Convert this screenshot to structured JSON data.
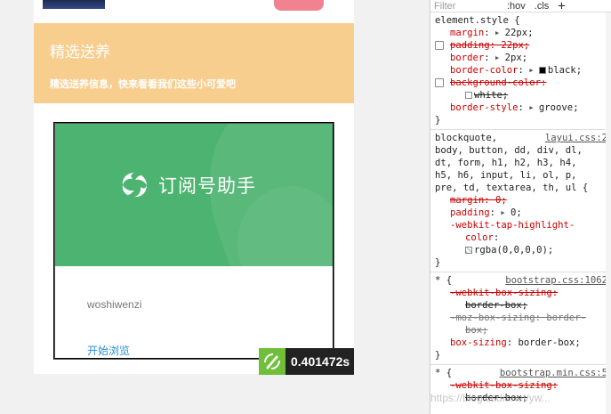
{
  "preview": {
    "banner_title": "精选送养",
    "banner_subtitle": "精选送养信息，快来看看我们这些小可爱吧",
    "card": {
      "logo_text": "订阅号助手",
      "author": "woshiwenzi",
      "link": "开始浏览"
    },
    "timer": "0.401472s",
    "colors": {
      "banner": "#f8ce8f",
      "cover": "#4db370",
      "accent_button": "#f0838f",
      "link": "#2a8fd6"
    }
  },
  "devtools": {
    "filter_placeholder": "Filter",
    "hov": ":hov",
    "cls": ".cls",
    "plus": "+",
    "r1": {
      "selector": "element.style {",
      "d1_name": "margin",
      "d1_val": "22px;",
      "d2": "padding: 22px;",
      "d3_name": "border",
      "d3_val": "2px;",
      "d4_name": "border-color",
      "d4_val": "black;",
      "d5": "background-color:",
      "d5_cont": "white;",
      "d6_name": "border-style",
      "d6_val": "groove;",
      "close": "}"
    },
    "r2": {
      "source": "layui.css:2",
      "sel1": "blockquote,",
      "sel2": "body, button, dd, div, dl,",
      "sel3": "dt, form, h1, h2, h3, h4,",
      "sel4": "h5, h6, input, li, ol, p,",
      "sel5": "pre, td, textarea, th, ul {",
      "d1": "margin: 0;",
      "d2_name": "padding",
      "d2_val": "0;",
      "d3_name": "-webkit-tap-highlight-",
      "d3_name2": "color",
      "d3_val": "rgba(0,0,0,0);",
      "close": "}"
    },
    "r3": {
      "selector": "* {",
      "source": "bootstrap.css:1062",
      "d1": "-webkit-box-sizing:",
      "d1_cont": "border-box;",
      "d2": "-moz-box-sizing: border-",
      "d2_cont": "box;",
      "d3_name": "box-sizing",
      "d3_val": "border-box;",
      "close": "}"
    },
    "r4": {
      "selector": "* {",
      "source": "bootstrap.min.css:5",
      "d1": "-webkit-box-sizing:",
      "d1_cont": "border-box;"
    },
    "watermark": "https://blog.csdn.net/yw...",
    "icons": {
      "logo": "swirl-logo-icon",
      "timer": "stopwatch-icon",
      "checkbox": "checkbox-icon",
      "expand": "triangle-right-icon"
    }
  }
}
